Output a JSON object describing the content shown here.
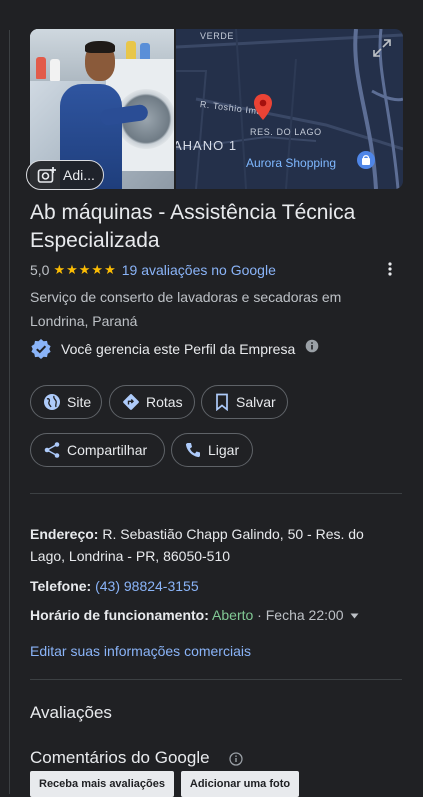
{
  "photos": {
    "add_photo_label": "Adi...",
    "map_labels": {
      "street_top": "VERDE",
      "street_toshio": "R. Toshio Imai",
      "district": "RES. DO LAGO",
      "area": "AHANO 1",
      "poi": "Aurora Shopping"
    }
  },
  "business": {
    "name": "Ab máquinas - Assistência Técnica Especializada",
    "rating": "5,0",
    "stars": "★★★★★",
    "reviews_link": "19 avaliações no Google",
    "category_line": "Serviço de conserto de lavadoras e secadoras em Londrina, Paraná",
    "manage_text": "Você gerencia este Perfil da Empresa"
  },
  "actions": {
    "site": "Site",
    "directions": "Rotas",
    "save": "Salvar",
    "share": "Compartilhar",
    "call": "Ligar"
  },
  "details": {
    "address_label": "Endereço:",
    "address_value": "R. Sebastião Chapp Galindo, 50 - Res. do Lago, Londrina - PR, 86050-510",
    "phone_label": "Telefone:",
    "phone_value": "(43) 98824-3155",
    "hours_label": "Horário de funcionamento:",
    "hours_open": "Aberto",
    "hours_separator": " · ",
    "hours_close": "Fecha 22:00",
    "edit_link": "Editar suas informações comerciais"
  },
  "reviews": {
    "section_title": "Avaliações",
    "google_title": "Comentários do Google",
    "get_more_button": "Receba mais avaliações",
    "add_photo_button": "Adicionar uma foto"
  },
  "colors": {
    "background": "#202124",
    "link": "#8ab4f8",
    "open": "#81c995",
    "star": "#fbbc04",
    "pin": "#ea4335"
  }
}
